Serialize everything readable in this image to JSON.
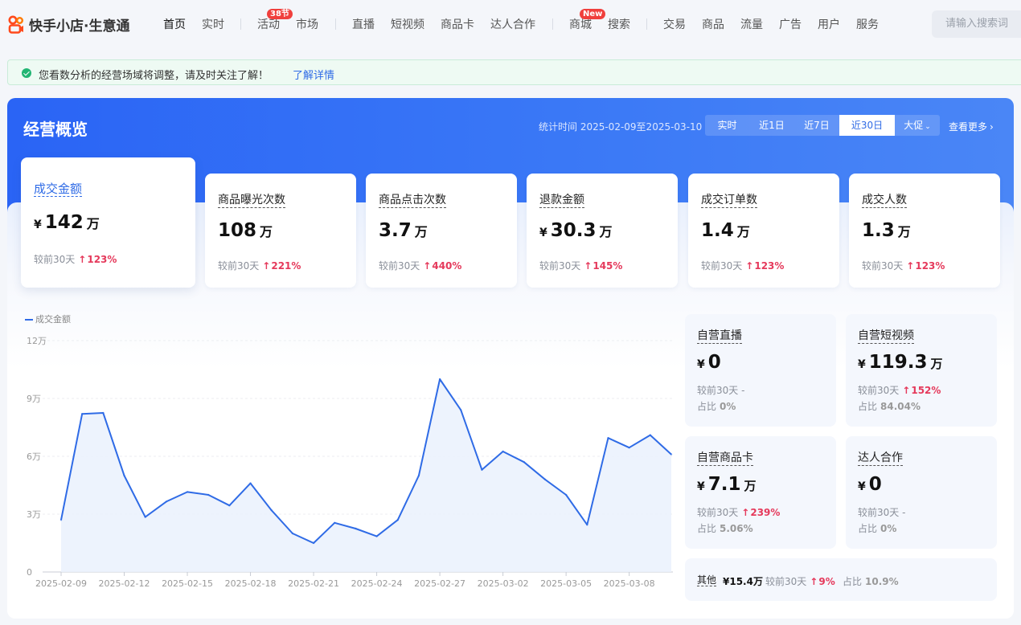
{
  "brand": {
    "name": "快手小店·生意通"
  },
  "nav": {
    "items": [
      {
        "label": "首页",
        "active": true
      },
      {
        "label": "实时"
      },
      {
        "label": "活动",
        "badge": "38节"
      },
      {
        "label": "市场"
      },
      {
        "label": "直播"
      },
      {
        "label": "短视频"
      },
      {
        "label": "商品卡"
      },
      {
        "label": "达人合作"
      },
      {
        "label": "商城",
        "badge": "New"
      },
      {
        "label": "搜索"
      },
      {
        "label": "交易"
      },
      {
        "label": "商品"
      },
      {
        "label": "流量"
      },
      {
        "label": "广告"
      },
      {
        "label": "用户"
      },
      {
        "label": "服务"
      }
    ],
    "search_placeholder": "请输入搜索词"
  },
  "notice": {
    "text": "您看数分析的经营场域将调整，请及时关注了解！",
    "link": "了解详情"
  },
  "overview": {
    "title": "经营概览",
    "stat_time": "统计时间 2025-02-09至2025-03-10",
    "ranges": [
      "实时",
      "近1日",
      "近7日",
      "近30日",
      "大促"
    ],
    "active_range": "近30日",
    "more": "查看更多",
    "metrics": [
      {
        "label": "成交金额",
        "currency": "¥",
        "value": "142",
        "unit": "万",
        "compare": "较前30天",
        "change": "123%"
      },
      {
        "label": "商品曝光次数",
        "currency": "",
        "value": "108",
        "unit": "万",
        "compare": "较前30天",
        "change": "221%"
      },
      {
        "label": "商品点击次数",
        "currency": "",
        "value": "3.7",
        "unit": "万",
        "compare": "较前30天",
        "change": "440%"
      },
      {
        "label": "退款金额",
        "currency": "¥",
        "value": "30.3",
        "unit": "万",
        "compare": "较前30天",
        "change": "145%"
      },
      {
        "label": "成交订单数",
        "currency": "",
        "value": "1.4",
        "unit": "万",
        "compare": "较前30天",
        "change": "123%"
      },
      {
        "label": "成交人数",
        "currency": "",
        "value": "1.3",
        "unit": "万",
        "compare": "较前30天",
        "change": "123%"
      }
    ]
  },
  "channels": [
    {
      "label": "自营直播",
      "currency": "¥",
      "value": "0",
      "unit": "",
      "compare": "较前30天",
      "change": "-",
      "share_label": "占比",
      "share": "0%"
    },
    {
      "label": "自营短视频",
      "currency": "¥",
      "value": "119.3",
      "unit": "万",
      "compare": "较前30天",
      "change": "152%",
      "share_label": "占比",
      "share": "84.04%"
    },
    {
      "label": "自营商品卡",
      "currency": "¥",
      "value": "7.1",
      "unit": "万",
      "compare": "较前30天",
      "change": "239%",
      "share_label": "占比",
      "share": "5.06%"
    },
    {
      "label": "达人合作",
      "currency": "¥",
      "value": "0",
      "unit": "",
      "compare": "较前30天",
      "change": "-",
      "share_label": "占比",
      "share": "0%"
    }
  ],
  "other": {
    "label": "其他",
    "value": "¥15.4万",
    "compare": "较前30天",
    "change": "9%",
    "share_label": "占比",
    "share": "10.9%"
  },
  "chart_data": {
    "type": "area",
    "series": [
      {
        "name": "成交金额",
        "values": [
          2.7,
          8.2,
          8.25,
          5.0,
          2.85,
          3.65,
          4.15,
          4.0,
          3.45,
          4.6,
          3.2,
          2.0,
          1.5,
          2.55,
          2.25,
          1.85,
          2.7,
          5.0,
          10.0,
          8.4,
          5.3,
          6.25,
          5.7,
          4.8,
          4.0,
          2.45,
          6.95,
          6.45,
          7.1,
          6.1
        ]
      }
    ],
    "x": [
      "2025-02-09",
      "2025-02-10",
      "2025-02-11",
      "2025-02-12",
      "2025-02-13",
      "2025-02-14",
      "2025-02-15",
      "2025-02-16",
      "2025-02-17",
      "2025-02-18",
      "2025-02-19",
      "2025-02-20",
      "2025-02-21",
      "2025-02-22",
      "2025-02-23",
      "2025-02-24",
      "2025-02-25",
      "2025-02-26",
      "2025-02-27",
      "2025-02-28",
      "2025-03-01",
      "2025-03-02",
      "2025-03-03",
      "2025-03-04",
      "2025-03-05",
      "2025-03-06",
      "2025-03-07",
      "2025-03-08",
      "2025-03-09",
      "2025-03-10"
    ],
    "xticks": [
      "2025-02-09",
      "2025-02-12",
      "2025-02-15",
      "2025-02-18",
      "2025-02-21",
      "2025-02-24",
      "2025-02-27",
      "2025-03-02",
      "2025-03-05",
      "2025-03-08"
    ],
    "yticks": [
      {
        "value": 0,
        "label": "0"
      },
      {
        "value": 3,
        "label": "3万"
      },
      {
        "value": 6,
        "label": "6万"
      },
      {
        "value": 9,
        "label": "9万"
      },
      {
        "value": 12,
        "label": "12万"
      }
    ],
    "ylim": [
      0,
      12
    ],
    "color": "#2f6be6",
    "legend": "top-left",
    "grid": true
  }
}
